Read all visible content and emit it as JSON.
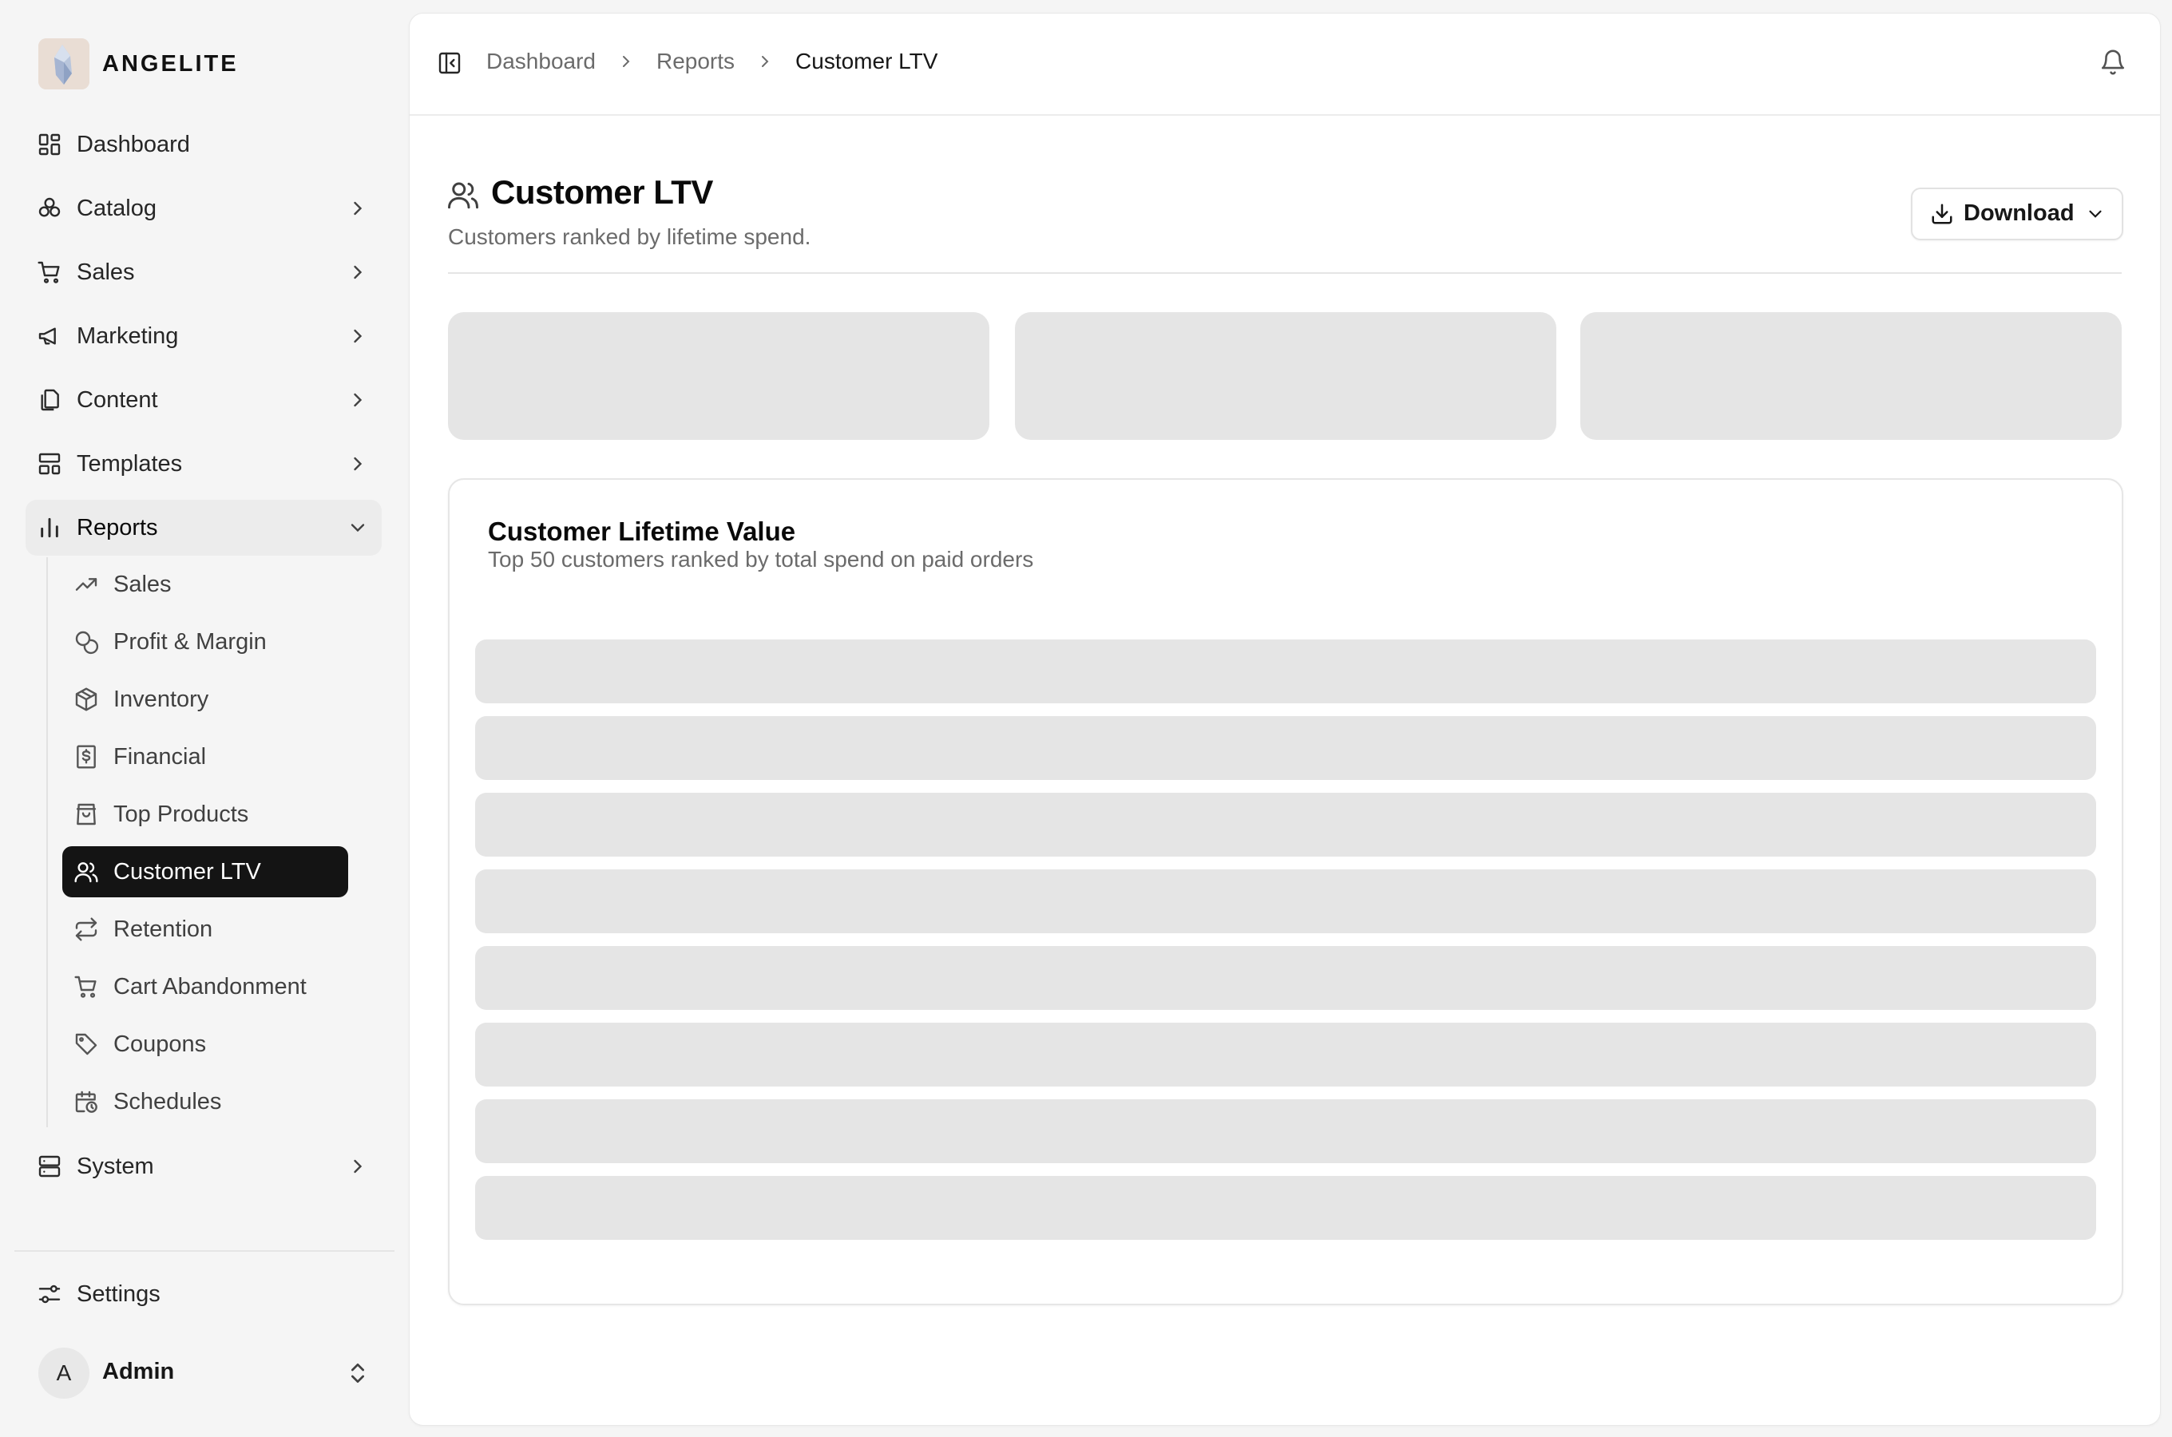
{
  "brand": {
    "name": "ANGELITE",
    "logo_icon": "crystal-logo"
  },
  "sidebar": {
    "items": [
      {
        "label": "Dashboard",
        "icon": "dashboard-icon"
      },
      {
        "label": "Catalog",
        "icon": "catalog-icon"
      },
      {
        "label": "Sales",
        "icon": "cart-icon"
      },
      {
        "label": "Marketing",
        "icon": "megaphone-icon"
      },
      {
        "label": "Content",
        "icon": "files-icon"
      },
      {
        "label": "Templates",
        "icon": "templates-icon"
      },
      {
        "label": "Reports",
        "icon": "bar-chart-icon",
        "expanded": true
      },
      {
        "label": "System",
        "icon": "server-icon"
      }
    ],
    "report_items": [
      {
        "label": "Sales",
        "icon": "trending-up-icon"
      },
      {
        "label": "Profit & Margin",
        "icon": "coins-icon"
      },
      {
        "label": "Inventory",
        "icon": "package-icon"
      },
      {
        "label": "Financial",
        "icon": "receipt-dollar-icon"
      },
      {
        "label": "Top Products",
        "icon": "shopping-bag-icon"
      },
      {
        "label": "Customer LTV",
        "icon": "users-icon",
        "active": true
      },
      {
        "label": "Retention",
        "icon": "repeat-icon"
      },
      {
        "label": "Cart Abandonment",
        "icon": "cart-icon"
      },
      {
        "label": "Coupons",
        "icon": "tag-icon"
      },
      {
        "label": "Schedules",
        "icon": "calendar-clock-icon"
      }
    ],
    "settings_label": "Settings",
    "user": {
      "initial": "A",
      "name": "Admin"
    }
  },
  "breadcrumb": [
    "Dashboard",
    "Reports",
    "Customer LTV"
  ],
  "page": {
    "title": "Customer LTV",
    "subtitle": "Customers ranked by lifetime spend.",
    "download_label": "Download"
  },
  "ltv_card": {
    "title": "Customer Lifetime Value",
    "subtitle": "Top 50 customers ranked by total spend on paid orders",
    "loading_rows": 8
  },
  "summary_cards_loading": 3,
  "colors": {
    "active_bg": "#141414",
    "skeleton": "#e5e5e5",
    "page_bg": "#f5f5f5"
  }
}
